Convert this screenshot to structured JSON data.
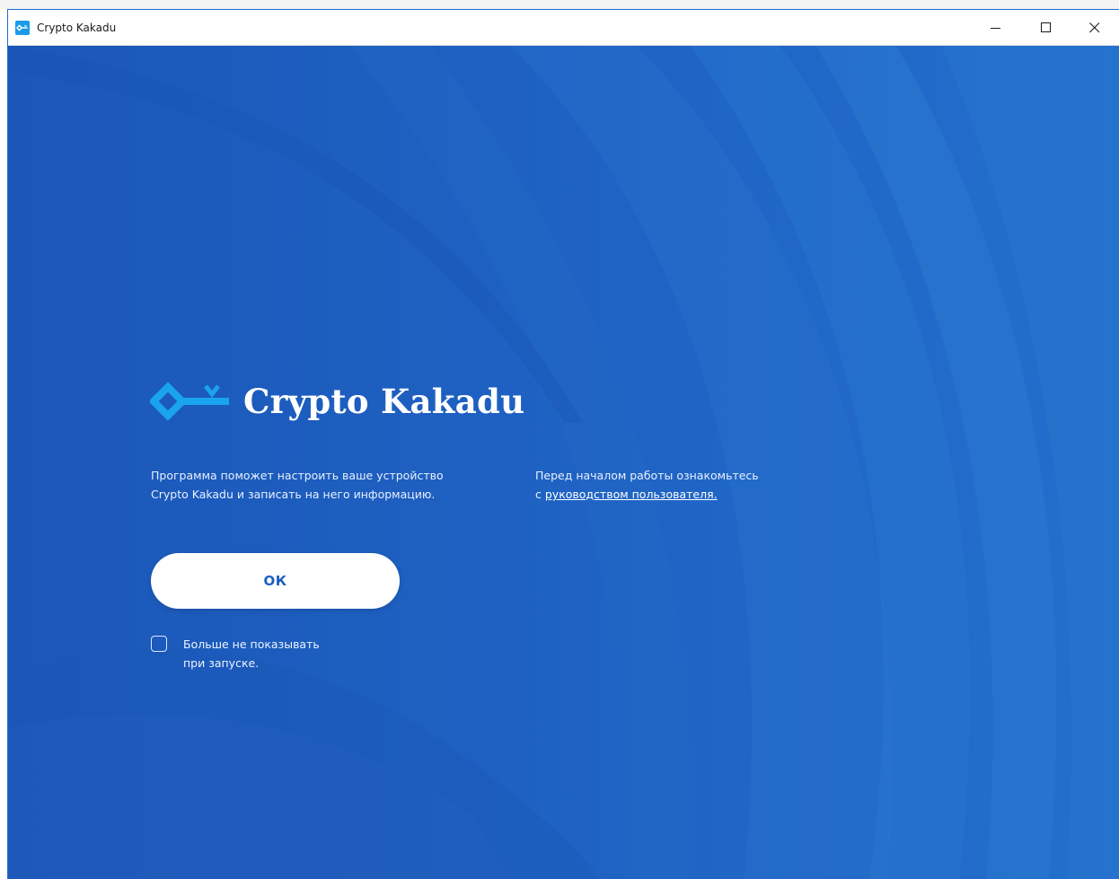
{
  "window": {
    "title": "Crypto Kakadu",
    "controls": {
      "minimize": "minimize-icon",
      "maximize": "maximize-icon",
      "close": "close-icon"
    }
  },
  "welcome": {
    "logo_text": "Crypto Kakadu",
    "description_left": [
      "Программа поможет настроить ваше устройство",
      "Crypto Kakadu и записать на него информацию."
    ],
    "description_right": {
      "line1": "Перед началом работы ознакомьтесь",
      "line2_prefix": "с ",
      "link_text": "руководством пользователя."
    },
    "ok_label": "ОК",
    "dont_show": {
      "line1": "Больше не показывать",
      "line2": "при запуске.",
      "checked": false
    }
  },
  "colors": {
    "background": "#1e5fbf",
    "logo_accent": "#1aa3ee",
    "button_text": "#1e5fbf"
  }
}
